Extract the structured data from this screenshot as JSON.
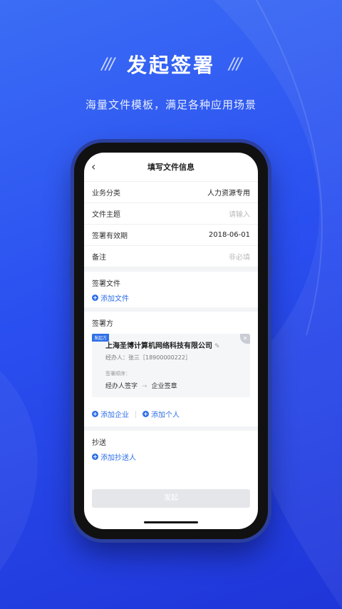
{
  "headline": {
    "title": "发起签署",
    "left_deco": "///",
    "right_deco": "///"
  },
  "subtitle": "海量文件模板，满足各种应用场景",
  "screen": {
    "nav": {
      "back_icon": "chevron-left-icon",
      "title": "填写文件信息"
    },
    "fields": [
      {
        "label": "业务分类",
        "value": "人力资源专用",
        "placeholder": ""
      },
      {
        "label": "文件主题",
        "value": "",
        "placeholder": "请输入"
      },
      {
        "label": "签署有效期",
        "value": "2018-06-01",
        "placeholder": ""
      },
      {
        "label": "备注",
        "value": "",
        "placeholder": "非必填"
      }
    ],
    "sign_file": {
      "title": "签署文件",
      "add_label": "添加文件"
    },
    "signers": {
      "title": "签署方",
      "card": {
        "badge": "发起方",
        "company": "上海圣博计算机网络科技有限公司",
        "handler": "经办人：张三［18900000222］",
        "order_label": "签署顺序：",
        "order_step1": "经办人签字",
        "order_arrow": "→",
        "order_step2": "企业签章"
      },
      "add_company": "添加企业",
      "add_person": "添加个人"
    },
    "cc": {
      "title": "抄送",
      "add_label": "添加抄送人"
    },
    "submit_label": "发起"
  },
  "colors": {
    "accent": "#2f6fe8",
    "background": "#2a4ff0"
  }
}
